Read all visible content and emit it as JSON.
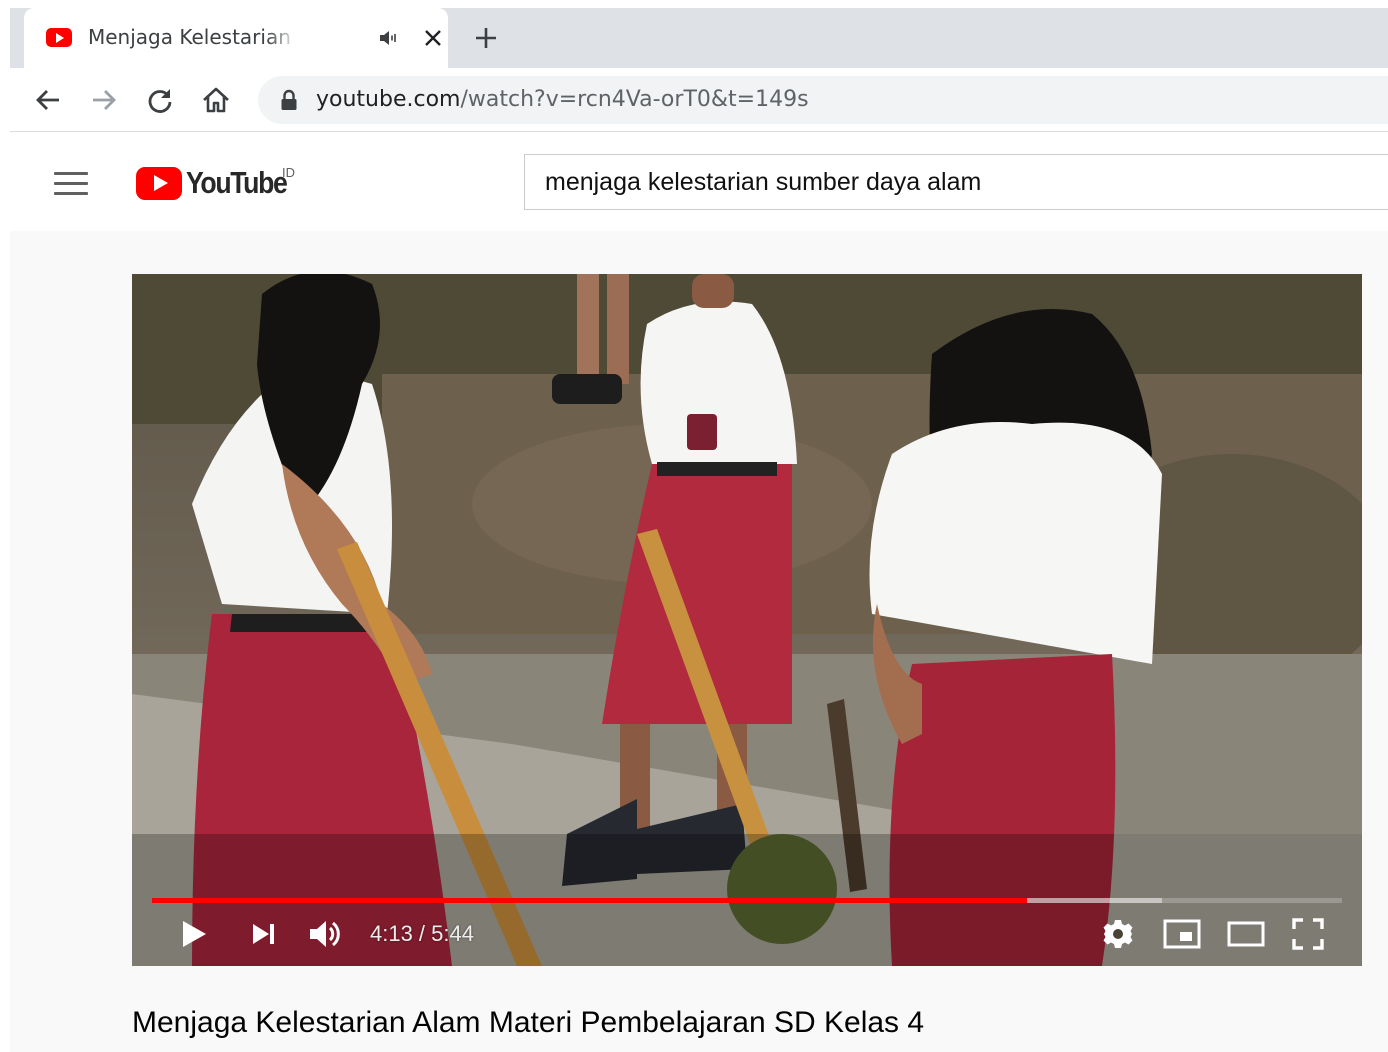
{
  "browser": {
    "tab": {
      "title": "Menjaga Kelestarian Alam M",
      "favicon": "youtube-favicon",
      "audio_icon": "speaker-icon",
      "close_icon": "close-icon"
    },
    "new_tab_icon": "plus-icon",
    "nav": {
      "back_icon": "arrow-left-icon",
      "forward_icon": "arrow-right-icon",
      "reload_icon": "reload-icon",
      "home_icon": "home-icon"
    },
    "address": {
      "lock_icon": "lock-icon",
      "host": "youtube.com",
      "path": "/watch?v=rcn4Va-orT0&t=149s"
    }
  },
  "youtube": {
    "menu_icon": "hamburger-icon",
    "logo_text": "YouTube",
    "country_code": "ID",
    "search_value": "menjaga kelestarian sumber daya alam"
  },
  "player": {
    "current_time": "4:13",
    "duration": "5:44",
    "time_display": "4:13 / 5:44",
    "progress_fraction": 0.735,
    "buffered_fraction": 0.849,
    "controls": [
      "play-icon",
      "next-icon",
      "volume-icon",
      "settings-icon",
      "miniplayer-icon",
      "theater-icon",
      "fullscreen-icon"
    ],
    "colors": {
      "progress": "#ff0000"
    }
  },
  "video": {
    "title": "Menjaga Kelestarian Alam Materi Pembelajaran SD Kelas 4"
  }
}
